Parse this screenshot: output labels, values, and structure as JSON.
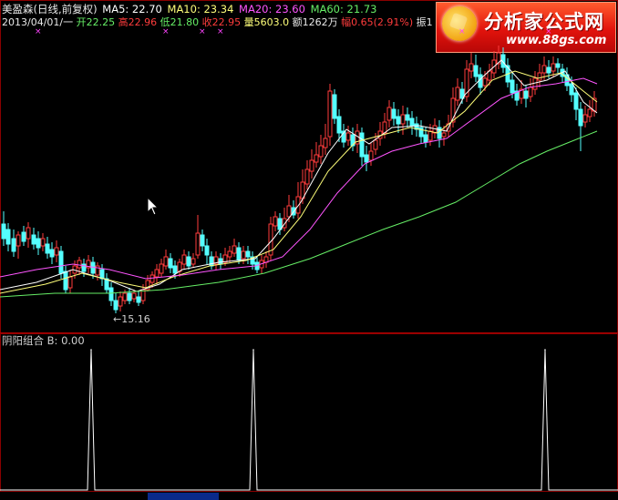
{
  "header": {
    "title": "美盈森(日线,前复权)",
    "ma5_label": "MA5: 22.70",
    "ma10_label": "MA10: 23.34",
    "ma20_label": "MA20: 23.60",
    "ma60_label": "MA60: 21.73",
    "date": "2013/04/01/一",
    "open_label": "开22.25",
    "high_label": "高22.96",
    "low_label": "低21.80",
    "close_label": "收22.95",
    "volume_label": "量5603.0",
    "amount_label": "额1262万",
    "change_label": "幅0.65(2.91%)",
    "amplitude_label": "振1",
    "colors": {
      "ma5": "#ffffff",
      "ma10": "#ffff7a",
      "ma20": "#ff55ff",
      "ma60": "#66ee66",
      "up": "#ff3c3c",
      "down": "#54ffff"
    }
  },
  "logo": {
    "brand": "分析家公式网",
    "site": "www.88gs.com",
    "icon": "gear-emblem-icon"
  },
  "main_chart": {
    "low_annotation": "←15.16"
  },
  "indicator_panel": {
    "label": "阴阳组合  B: 0.00"
  },
  "chart_data": [
    {
      "type": "candlestick",
      "series": [
        {
          "name": "MA5"
        },
        {
          "name": "MA10"
        },
        {
          "name": "MA20"
        },
        {
          "name": "MA60"
        }
      ]
    },
    {
      "type": "line",
      "x": [
        0,
        96,
        100,
        104,
        274,
        278,
        282,
        594,
        598,
        602,
        678
      ],
      "values": [
        0,
        0,
        1,
        0,
        0,
        1,
        0,
        0,
        1,
        0,
        0
      ],
      "ylim": [
        0,
        1
      ],
      "series": [
        {
          "name": "B"
        }
      ]
    }
  ]
}
